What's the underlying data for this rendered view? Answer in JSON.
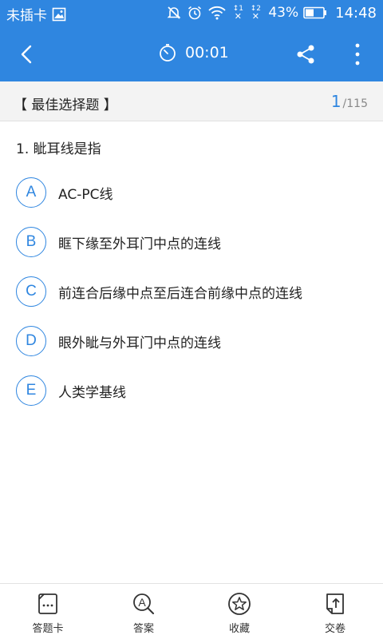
{
  "status_bar": {
    "carrier": "未插卡",
    "sim1": "1",
    "sim2": "2",
    "battery_percent": "43%",
    "time": "14:48"
  },
  "toolbar": {
    "timer": "00:01"
  },
  "section": {
    "title": "【 最佳选择题 】",
    "current": "1",
    "total": "/115"
  },
  "question": {
    "text": "1. 眦耳线是指",
    "options": [
      {
        "letter": "A",
        "text": "AC-PC线"
      },
      {
        "letter": "B",
        "text": "眶下缘至外耳门中点的连线"
      },
      {
        "letter": "C",
        "text": "前连合后缘中点至后连合前缘中点的连线"
      },
      {
        "letter": "D",
        "text": "眼外眦与外耳门中点的连线"
      },
      {
        "letter": "E",
        "text": "人类学基线"
      }
    ]
  },
  "bottom_nav": {
    "items": [
      {
        "label": "答题卡",
        "icon": "answer-card-icon"
      },
      {
        "label": "答案",
        "icon": "answer-search-icon"
      },
      {
        "label": "收藏",
        "icon": "star-icon"
      },
      {
        "label": "交卷",
        "icon": "submit-paper-icon"
      }
    ]
  },
  "colors": {
    "primary": "#2f86e0",
    "header_bg": "#f3f3f3"
  }
}
